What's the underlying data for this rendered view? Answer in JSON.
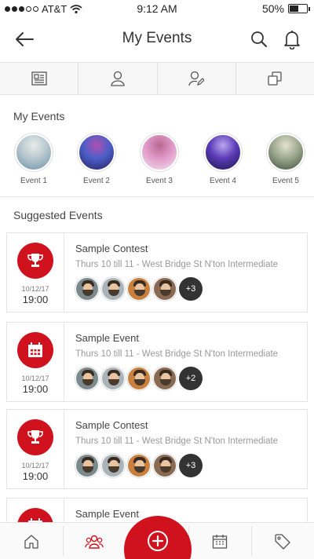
{
  "status": {
    "carrier": "AT&T",
    "time": "9:12 AM",
    "battery": "50%",
    "battery_level": 0.5
  },
  "header": {
    "title": "My Events"
  },
  "tabs": [
    {
      "icon": "newspaper-icon"
    },
    {
      "icon": "person-icon"
    },
    {
      "icon": "person-edit-icon"
    },
    {
      "icon": "cards-icon"
    }
  ],
  "my_events": {
    "title": "My Events",
    "items": [
      {
        "label": "Event  1",
        "colors": [
          "#6f8fa8",
          "#b7c7cf",
          "#e6ece8"
        ]
      },
      {
        "label": "Event 2",
        "colors": [
          "#2a1f5a",
          "#4a5fc8",
          "#b14fb0"
        ]
      },
      {
        "label": "Event 3",
        "colors": [
          "#f3e3ef",
          "#e099c9",
          "#b7698f"
        ]
      },
      {
        "label": "Event 4",
        "colors": [
          "#1c1848",
          "#5b3ab7",
          "#b9a8f0"
        ]
      },
      {
        "label": "Event 5",
        "colors": [
          "#3f4f3c",
          "#9aa78c",
          "#e7e2d3"
        ]
      }
    ]
  },
  "suggested": {
    "title": "Suggested Events",
    "cards": [
      {
        "icon": "trophy-icon",
        "date": "10/12/17",
        "time": "19:00",
        "title": "Sample Contest",
        "subtitle": "Thurs 10 till 11 - West Bridge St N'ton Intermediate",
        "more": "+3"
      },
      {
        "icon": "calendar-icon",
        "date": "10/12/17",
        "time": "19:00",
        "title": "Sample Event",
        "subtitle": "Thurs 10 till 11 - West Bridge St N'ton Intermediate",
        "more": "+2"
      },
      {
        "icon": "trophy-icon",
        "date": "10/12/17",
        "time": "19:00",
        "title": "Sample Contest",
        "subtitle": "Thurs 10 till 11 - West Bridge St N'ton Intermediate",
        "more": "+3"
      },
      {
        "icon": "calendar-icon",
        "date": "",
        "time": "",
        "title": "Sample Event",
        "subtitle": "",
        "more": ""
      }
    ]
  },
  "avatar_colors": [
    "#7a8a8e",
    "#a9b3b8",
    "#c9803f",
    "#8a6a52"
  ],
  "bottom_nav": [
    {
      "icon": "home-icon"
    },
    {
      "icon": "group-icon"
    },
    {
      "icon": "add-icon"
    },
    {
      "icon": "calendar-icon"
    },
    {
      "icon": "tag-icon"
    }
  ],
  "accent": "#d0121e"
}
